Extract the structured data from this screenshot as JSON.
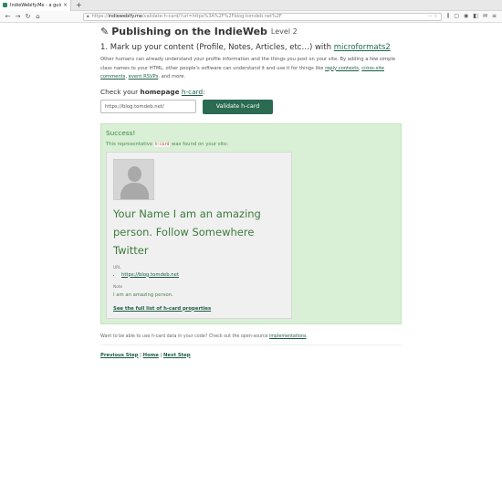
{
  "browser": {
    "tab_title": "IndieWebify.Me - a guide",
    "tab_close": "×",
    "new_tab": "+",
    "url_prefix": "https://",
    "url_host": "indiewebify.me",
    "url_path": "/validate-h-card/?url=https%3A%2F%2Fblog.tomdeb.net%2F",
    "nav": {
      "back": "←",
      "forward": "→",
      "reload": "↻",
      "home": "⌂"
    },
    "page_actions": "··· ☆",
    "tools": [
      "⫼",
      "▢",
      "◉",
      "◧",
      "✉",
      "≡"
    ]
  },
  "page": {
    "title": "Publishing on the IndieWeb",
    "level": "Level 2",
    "step_heading": "1. Mark up your content (Profile, Notes, Articles, etc…) with ",
    "step_link": "microformats2",
    "intro_1": "Other humans can already understand your profile information and the things you post on your site. By adding a few simple class names to your HTML, other people's software can understand it and use it for things like ",
    "intro_link_1": "reply contexts",
    "intro_sep_1": ", ",
    "intro_link_2": "cross-site comments",
    "intro_sep_2": ", ",
    "intro_link_3": "event RSVPs",
    "intro_end": ", and more.",
    "check_prefix": "Check your ",
    "check_bold": "homepage",
    "check_link": "h-card",
    "check_suffix": ":",
    "input_value": "https://blog.tomdeb.net/",
    "validate_label": "Validate h-card"
  },
  "result": {
    "title": "Success!",
    "desc_prefix": "This representative ",
    "desc_code": "h-card",
    "desc_suffix": " was found on your site:",
    "card_name": "Your Name I am an amazing person. Follow Somewhere Twitter",
    "url_label": "URL",
    "url_value": "https://blog.tomdeb.net",
    "note_label": "Note",
    "note_text": "I am an amazing person.",
    "full_list": "See the full list of h-card properties"
  },
  "footer": {
    "note_prefix": "Want to be able to use h-card data in your code? Check out the open-source ",
    "note_link": "implementations",
    "note_suffix": ".",
    "prev": "Previous Step",
    "home": "Home",
    "next": "Next Step",
    "sep": " | "
  },
  "colors": {
    "accent": "#2a6b51",
    "success_bg": "#d9efd6",
    "success_text": "#3a8a3a"
  }
}
